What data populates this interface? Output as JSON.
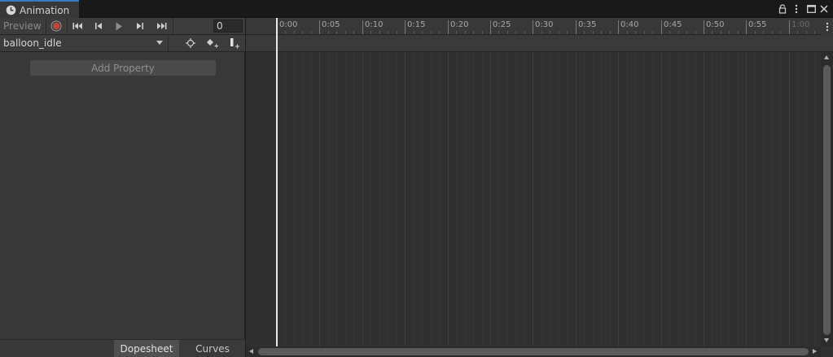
{
  "window": {
    "tab_title": "Animation",
    "icons": [
      "clock-icon",
      "lock-icon",
      "kebab-menu-icon",
      "maximize-icon",
      "close-icon"
    ]
  },
  "controls": {
    "preview_label": "Preview",
    "frame_value": "0",
    "buttons": [
      "record",
      "first-keyframe",
      "previous-keyframe",
      "play",
      "next-keyframe",
      "last-keyframe"
    ]
  },
  "clip": {
    "selected": "balloon_idle",
    "tools": [
      "filter-by-selection",
      "add-keyframe",
      "add-event"
    ]
  },
  "properties": {
    "add_property_label": "Add Property"
  },
  "modes": {
    "dopesheet_label": "Dopesheet",
    "curves_label": "Curves",
    "active": "Dopesheet"
  },
  "timeline": {
    "ticks": [
      "0:00",
      "0:05",
      "0:10",
      "0:15",
      "0:20",
      "0:25",
      "0:30",
      "0:35",
      "0:40",
      "0:45",
      "0:50",
      "0:55",
      "1:00"
    ],
    "playhead_frame": 0
  },
  "colors": {
    "accent_tab": "#3a79bb",
    "record_red": "#c0463d",
    "panel_bg": "#383838",
    "timeline_bg": "#303030"
  }
}
